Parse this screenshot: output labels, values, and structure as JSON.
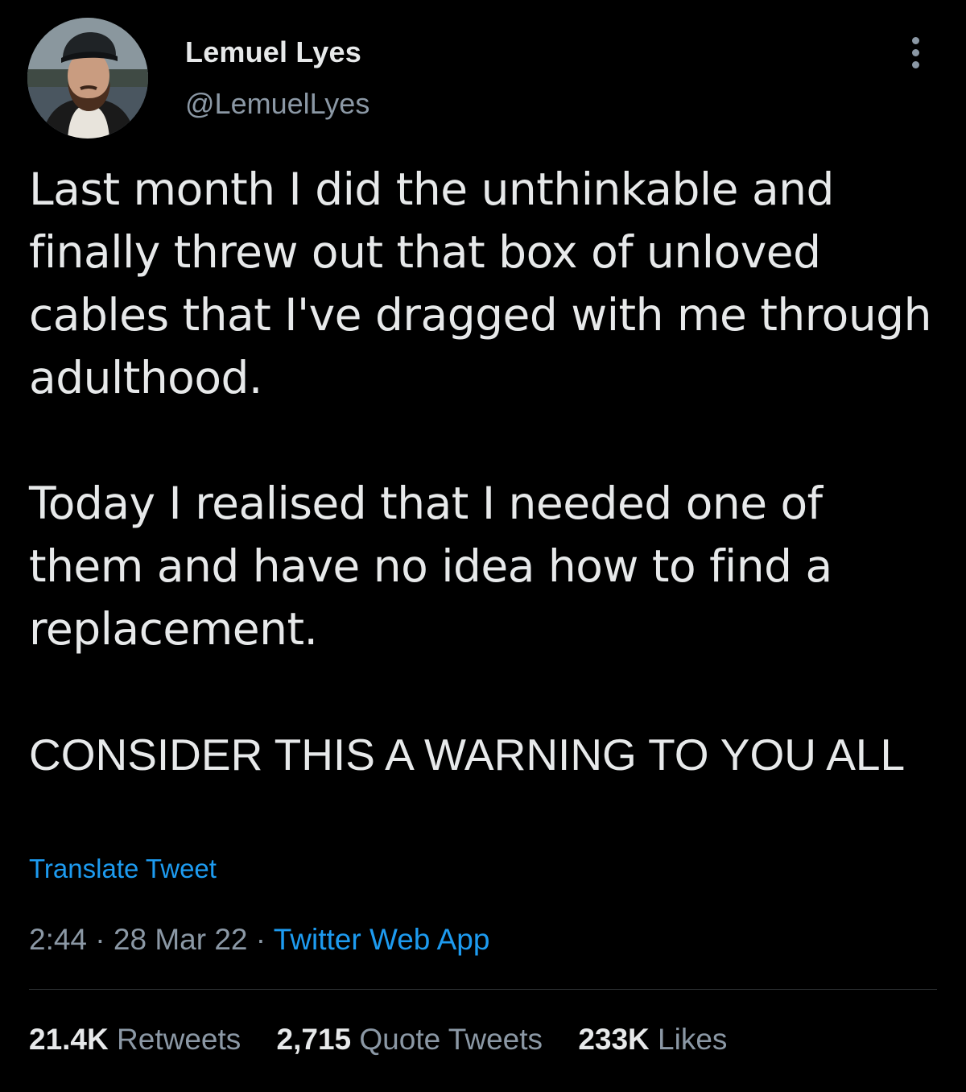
{
  "author": {
    "display_name": "Lemuel Lyes",
    "handle": "@LemuelLyes",
    "avatar_icon": "profile-photo"
  },
  "menu": {
    "icon": "more-dots-icon"
  },
  "tweet": {
    "paragraphs": [
      "Last month I did the unthinkable and finally threw out that box of unloved cables that I've dragged with me through adulthood.",
      "Today I realised that I needed one of them and have no idea how to find a replacement.",
      "CONSIDER THIS A WARNING TO YOU ALL"
    ],
    "translate_label": "Translate Tweet",
    "time": "2:44",
    "separator": " · ",
    "date": "28 Mar 22",
    "source": "Twitter Web App"
  },
  "stats": {
    "retweets_count": "21.4K",
    "retweets_label": "Retweets",
    "quotes_count": "2,715",
    "quotes_label": "Quote Tweets",
    "likes_count": "233K",
    "likes_label": "Likes"
  },
  "colors": {
    "background": "#000000",
    "text_primary": "#e7e9ea",
    "text_secondary": "#8b98a5",
    "link": "#1d9bf0",
    "divider": "#2f3336"
  }
}
